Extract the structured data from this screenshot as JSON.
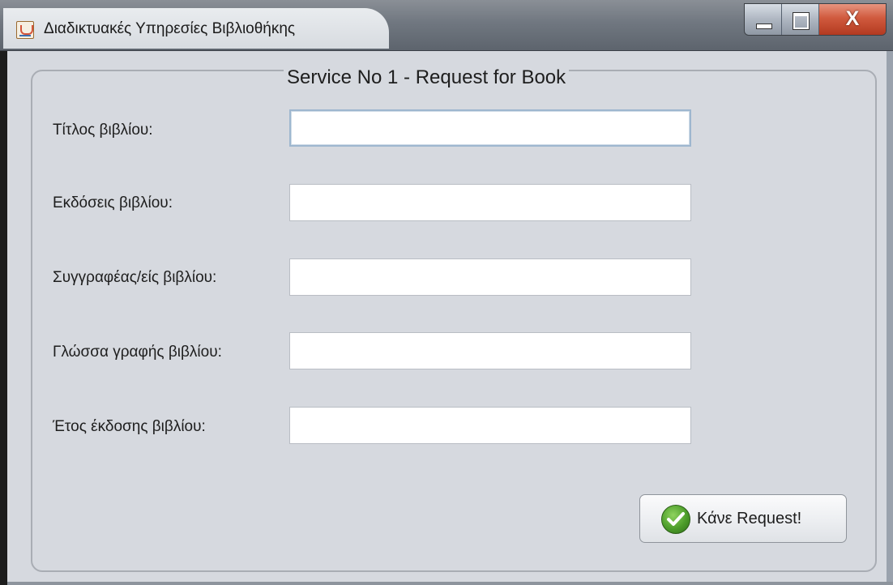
{
  "window": {
    "title": "Διαδικτυακές Υπηρεσίες Βιβλιοθήκης",
    "controls": {
      "minimize_icon": "minimize-icon",
      "maximize_icon": "maximize-icon",
      "close_label": "X"
    },
    "app_icon": "java-icon"
  },
  "panel": {
    "title": "Service No 1 - Request for Book"
  },
  "form": {
    "fields": [
      {
        "label": "Τίτλος βιβλίου:",
        "value": "",
        "placeholder": ""
      },
      {
        "label": "Εκδόσεις βιβλίου:",
        "value": "",
        "placeholder": ""
      },
      {
        "label": "Συγγραφέας/είς βιβλίου:",
        "value": "",
        "placeholder": ""
      },
      {
        "label": "Γλώσσα γραφής βιβλίου:",
        "value": "",
        "placeholder": ""
      },
      {
        "label": "Έτος έκδοσης βιβλίου:",
        "value": "",
        "placeholder": ""
      }
    ],
    "submit": {
      "label": "Κάνε Request!",
      "icon": "check-icon"
    }
  },
  "colors": {
    "background": "#d6d9df",
    "accent_focus": "#9eb7cf",
    "check_green": "#4c9d2a",
    "close_red": "#c4472c"
  }
}
